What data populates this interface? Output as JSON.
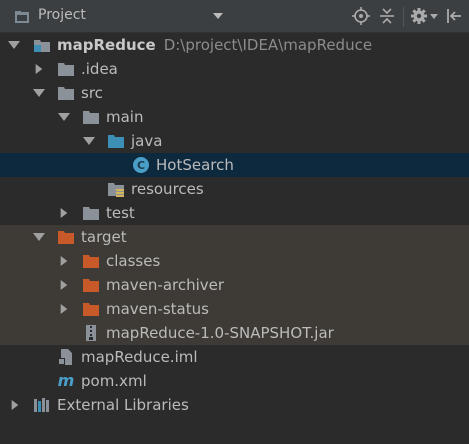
{
  "header": {
    "view_label": "Project"
  },
  "tree": {
    "project": {
      "name": "mapReduce",
      "path": "D:\\project\\IDEA\\mapReduce"
    },
    "idea": ".idea",
    "src": "src",
    "main": "main",
    "java": "java",
    "hotsearch": "HotSearch",
    "resources": "resources",
    "test": "test",
    "target": "target",
    "classes": "classes",
    "maven_archiver": "maven-archiver",
    "maven_status": "maven-status",
    "jar": "mapReduce-1.0-SNAPSHOT.jar",
    "iml": "mapReduce.iml",
    "pom": "pom.xml",
    "external_libraries": "External Libraries"
  },
  "colors": {
    "background": "#2b2b2b",
    "selected_row": "#0d293e",
    "excluded_row": "#3e3a35",
    "folder_gray": "#8a9199",
    "folder_blue": "#3d8fb5",
    "folder_orange": "#c75a28",
    "class_icon": "#4a9fc9"
  }
}
